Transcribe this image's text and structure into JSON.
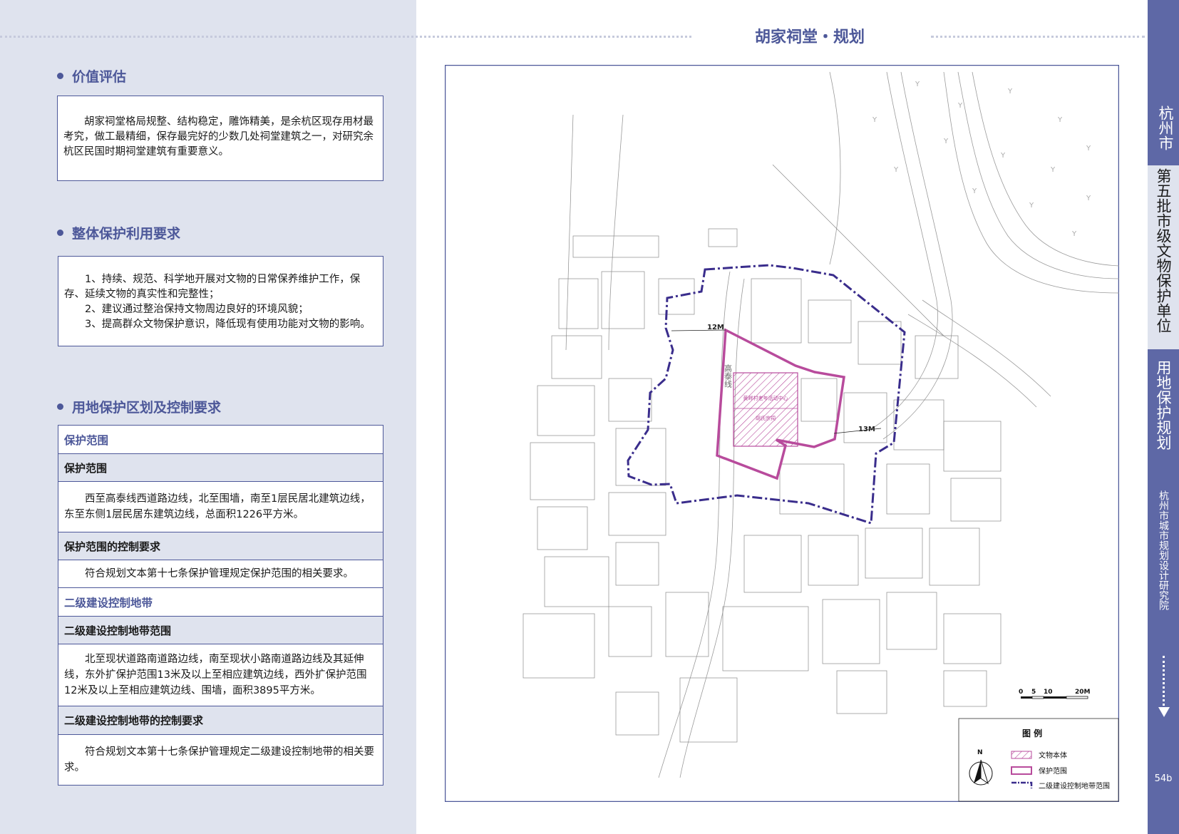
{
  "page": {
    "title": "胡家祠堂・规划",
    "page_number": "54b"
  },
  "sidebar": {
    "city": "杭州市",
    "series": "第五批市级文物保护单位",
    "section": "用地保护规划",
    "org": "杭州市城市规划设计研究院"
  },
  "value_assessment": {
    "heading": "价值评估",
    "text": "胡家祠堂格局规整、结构稳定，雕饰精美，是余杭区现存用材最考究，做工最精细，保存最完好的少数几处祠堂建筑之一，对研究余杭区民国时期祠堂建筑有重要意义。"
  },
  "overall_requirements": {
    "heading": "整体保护利用要求",
    "items": [
      "1、持续、规范、科学地开展对文物的日常保养维护工作，保存、延续文物的真实性和完整性；",
      "2、建议通过整治保持文物周边良好的环境风貌；",
      "3、提高群众文物保护意识，降低现有使用功能对文物的影响。"
    ]
  },
  "land_protection": {
    "heading": "用地保护区划及控制要求",
    "protection_zone": {
      "section_title": "保护范围",
      "range_title": "保护范围",
      "range_text": "西至高泰线西道路边线，北至围墙，南至1层民居北建筑边线，东至东侧1层民居东建筑边线，总面积1226平方米。",
      "control_title": "保护范围的控制要求",
      "control_text": "符合规划文本第十七条保护管理规定保护范围的相关要求。"
    },
    "construction_zone": {
      "section_title": "二级建设控制地带",
      "range_title": "二级建设控制地带范围",
      "range_text": "北至现状道路南道路边线，南至现状小路南道路边线及其延伸线，东外扩保护范围13米及以上至相应建筑边线，西外扩保护范围12米及以上至相应建筑边线、围墙，面积3895平方米。",
      "control_title": "二级建设控制地带的控制要求",
      "control_text": "符合规划文本第十七条保护管理规定二级建设控制地带的相关要求。"
    }
  },
  "map": {
    "dimension_west": "12M",
    "dimension_east": "13M",
    "road_label": "高泰线",
    "site_labels": [
      "黄畔村老年活动中心",
      "胡氏宗祠"
    ],
    "scale_ticks": [
      "0",
      "5",
      "10",
      "20M"
    ],
    "north": "N",
    "legend": {
      "title": "图 例",
      "items": [
        {
          "label": "文物本体",
          "color": "#b84b9c"
        },
        {
          "label": "保护范围",
          "color": "#b84b9c"
        },
        {
          "label": "二级建设控制地带范围",
          "color": "#3a2d8c"
        }
      ]
    }
  },
  "colors": {
    "accent": "#4d5899",
    "panel_bg": "#dfe3ee",
    "protection": "#b84b9c",
    "control_zone": "#3a2d8c"
  }
}
